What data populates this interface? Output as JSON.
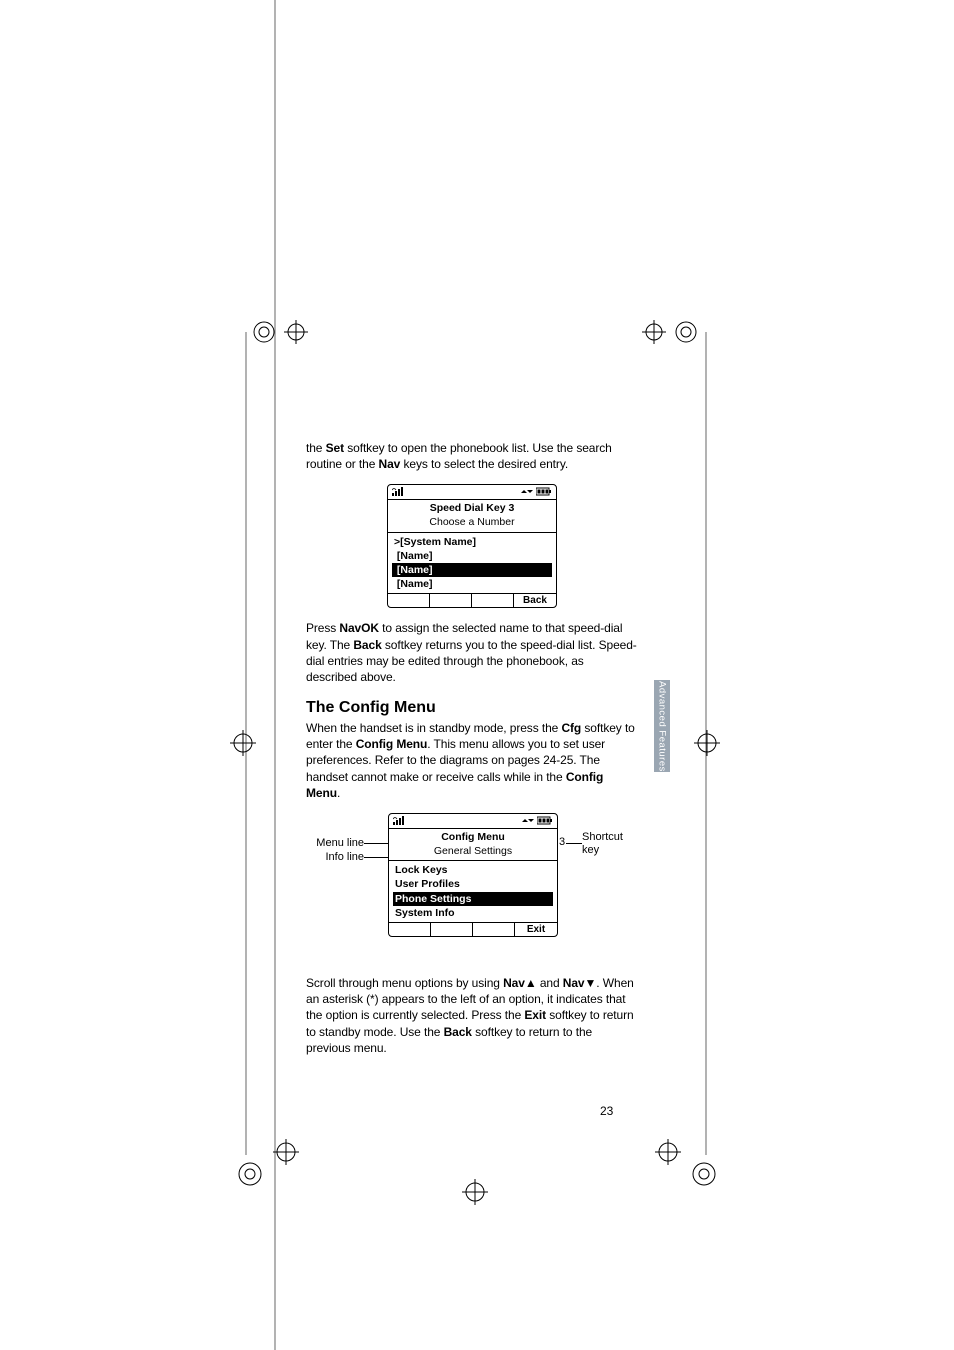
{
  "intro_para": {
    "pre": "the ",
    "set": "Set",
    "mid": " softkey to open the phonebook list. Use the search routine or the ",
    "nav": "Nav",
    "post": " keys to select the desired entry."
  },
  "screen1": {
    "title": "Speed Dial Key 3",
    "subtitle": "Choose a Number",
    "rows": [
      {
        "text": ">[System Name]",
        "hl": false
      },
      {
        "text": " [Name]",
        "hl": false
      },
      {
        "text": " [Name]",
        "hl": true
      },
      {
        "text": " [Name]",
        "hl": false
      }
    ],
    "softkeys": [
      "",
      "",
      "",
      "Back"
    ]
  },
  "mid_para": {
    "t1": "Press ",
    "navok": "NavOK",
    "t2": " to assign the selected name to that speed-dial key. The ",
    "back": "Back",
    "t3": " softkey returns you to the speed-dial list. Speed-dial entries may be edited through the phonebook, as described above."
  },
  "heading": "The Config Menu",
  "cfg_para": {
    "t1": "When the handset is in standby mode, press the ",
    "cfg": "Cfg",
    "t2": " softkey to enter the ",
    "menu": "Config Menu",
    "t3": ". This menu allows you to set user preferences. Refer to the diagrams on pages 24-25. The handset cannot make or receive calls while in the ",
    "menu2": "Config Menu",
    "t4": "."
  },
  "screen2": {
    "title": "Config Menu",
    "subtitle": "General Settings",
    "shortcut": "3",
    "rows": [
      {
        "text": "Lock Keys",
        "hl": false
      },
      {
        "text": "User Profiles",
        "hl": false
      },
      {
        "text": "Phone Settings",
        "hl": true
      },
      {
        "text": "System Info",
        "hl": false
      }
    ],
    "softkeys": [
      "",
      "",
      "",
      "Exit"
    ]
  },
  "callouts": {
    "menuline": "Menu line",
    "infoline": "Info line",
    "shortcut": "Shortcut key"
  },
  "scroll_para": {
    "t1": "Scroll through menu options by using ",
    "navup": "Nav",
    "t2": " and ",
    "navdn": "Nav",
    "t3": ". When an asterisk (*) appears to the left of an option, it indicates that the option is currently selected. Press the ",
    "exit": "Exit",
    "t4": " softkey to return to standby mode. Use the ",
    "back": "Back",
    "t5": " softkey to return to the previous menu."
  },
  "side_tab": "Advanced Features",
  "page_number": "23",
  "icons": {
    "up_tri": "▲",
    "dn_tri": "▼"
  }
}
